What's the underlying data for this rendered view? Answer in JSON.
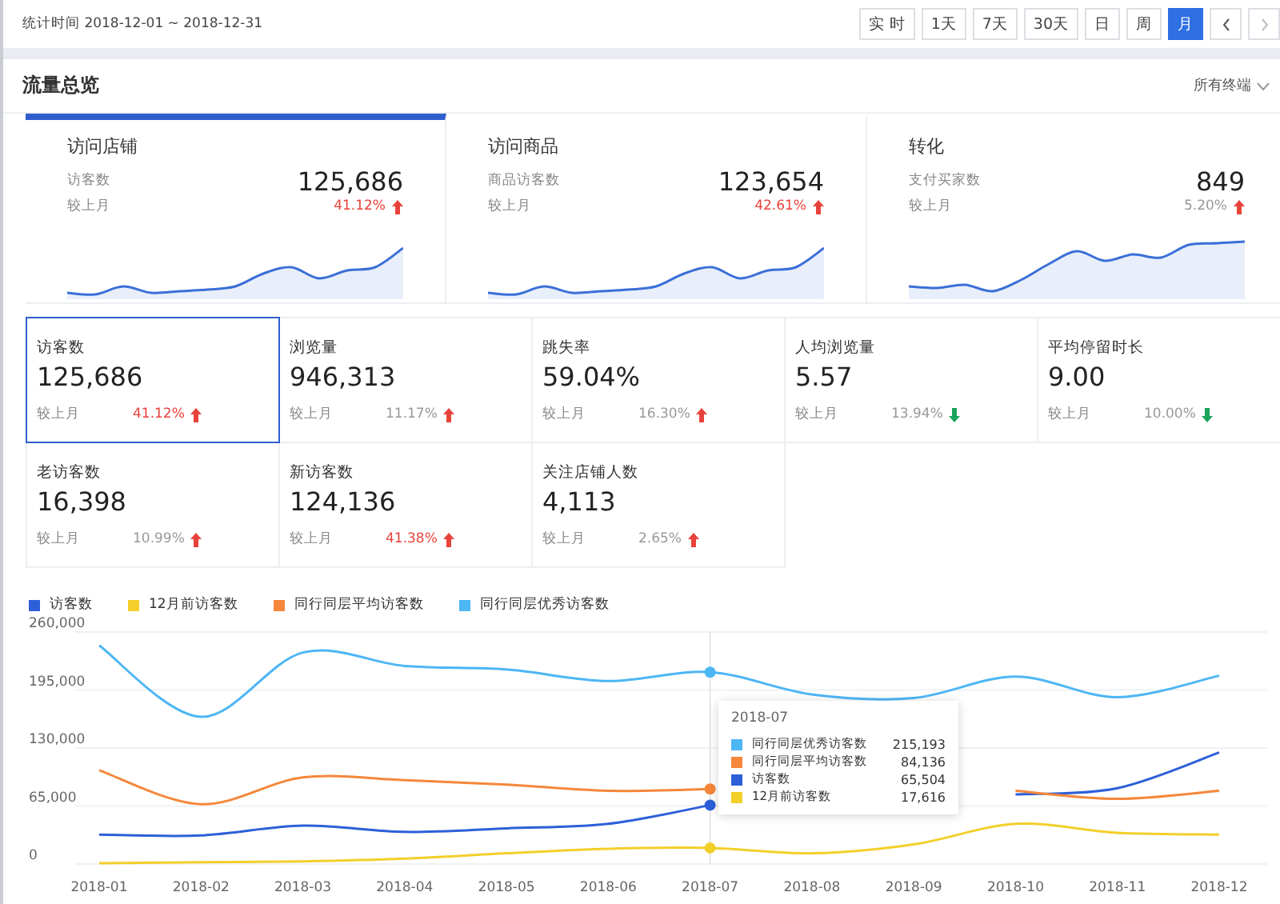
{
  "top_bar": {
    "date_range": "统计时间 2018-12-01 ~ 2018-12-31",
    "ranges": [
      {
        "label": "实 时",
        "selected": false
      },
      {
        "label": "1天",
        "selected": false
      },
      {
        "label": "7天",
        "selected": false
      },
      {
        "label": "30天",
        "selected": false
      },
      {
        "label": "日",
        "selected": false
      },
      {
        "label": "周",
        "selected": false
      },
      {
        "label": "月",
        "selected": true
      }
    ]
  },
  "panel": {
    "title": "流量总览",
    "terminal_select": "所有终端"
  },
  "summary_cards": [
    {
      "title": "访问店铺",
      "label": "访客数",
      "value": "125,686",
      "compare_label": "较上月",
      "change": "41.12%",
      "highlight": true,
      "rising": true,
      "selected": true
    },
    {
      "title": "访问商品",
      "label": "商品访客数",
      "value": "123,654",
      "compare_label": "较上月",
      "change": "42.61%",
      "highlight": true,
      "rising": true,
      "selected": false
    },
    {
      "title": "转化",
      "label": "支付买家数",
      "value": "849",
      "compare_label": "较上月",
      "change": "5.20%",
      "highlight": false,
      "rising": true,
      "selected": false
    }
  ],
  "metrics": [
    {
      "label": "访客数",
      "value": "125,686",
      "compare_label": "较上月",
      "change": "41.12%",
      "highlight": true,
      "rising": true,
      "selected": true
    },
    {
      "label": "浏览量",
      "value": "946,313",
      "compare_label": "较上月",
      "change": "11.17%",
      "highlight": false,
      "rising": true,
      "selected": false
    },
    {
      "label": "跳失率",
      "value": "59.04%",
      "compare_label": "较上月",
      "change": "16.30%",
      "highlight": false,
      "rising": true,
      "selected": false
    },
    {
      "label": "人均浏览量",
      "value": "5.57",
      "compare_label": "较上月",
      "change": "13.94%",
      "highlight": false,
      "rising": false,
      "selected": false
    },
    {
      "label": "平均停留时长",
      "value": "9.00",
      "compare_label": "较上月",
      "change": "10.00%",
      "highlight": false,
      "rising": false,
      "selected": false
    },
    {
      "label": "老访客数",
      "value": "16,398",
      "compare_label": "较上月",
      "change": "10.99%",
      "highlight": false,
      "rising": true,
      "selected": false
    },
    {
      "label": "新访客数",
      "value": "124,136",
      "compare_label": "较上月",
      "change": "41.38%",
      "highlight": true,
      "rising": true,
      "selected": false
    },
    {
      "label": "关注店铺人数",
      "value": "4,113",
      "compare_label": "较上月",
      "change": "2.65%",
      "highlight": false,
      "rising": true,
      "selected": false
    }
  ],
  "trend_chart": {
    "chart_data": {
      "type": "line",
      "grid": true,
      "ref_lines": [
        {
          "axis": "x",
          "value": "2018-07"
        }
      ],
      "categories": [
        "2018-01",
        "2018-02",
        "2018-03",
        "2018-04",
        "2018-05",
        "2018-06",
        "2018-07",
        "2018-08",
        "2018-09",
        "2018-10",
        "2018-11",
        "2018-12"
      ],
      "ylim": [
        0,
        260000
      ],
      "yticks": [
        {
          "value": 0,
          "label": "0"
        },
        {
          "value": 65000,
          "label": "65,000"
        },
        {
          "value": 130000,
          "label": "130,000"
        },
        {
          "value": 195000,
          "label": "195,000"
        },
        {
          "value": 260000,
          "label": "260,000"
        }
      ],
      "series": [
        {
          "name": "访客数",
          "color": "#2d5fd8",
          "values": [
            33000,
            32000,
            43000,
            36000,
            40000,
            45000,
            66000,
            null,
            null,
            78000,
            85000,
            125000
          ]
        },
        {
          "name": "12月前访客数",
          "color": "#f3cf2a",
          "values": [
            1000,
            2000,
            3000,
            6000,
            12000,
            17000,
            18000,
            12000,
            22000,
            45000,
            35000,
            33000
          ]
        },
        {
          "name": "同行同层平均访客数",
          "color": "#f5873a",
          "values": [
            105000,
            67000,
            97000,
            94000,
            89000,
            82000,
            84000,
            null,
            null,
            82000,
            73000,
            82000
          ]
        },
        {
          "name": "同行同层优秀访客数",
          "color": "#4db6f5",
          "values": [
            245000,
            165000,
            237000,
            222000,
            218000,
            205000,
            215000,
            190000,
            186000,
            210000,
            187000,
            211000
          ]
        }
      ]
    },
    "tooltip": {
      "title": "2018-07",
      "rows": [
        {
          "name": "同行同层优秀访客数",
          "value": "215,193",
          "color": "#4db6f5"
        },
        {
          "name": "同行同层平均访客数",
          "value": "84,136",
          "color": "#f5873a"
        },
        {
          "name": "访客数",
          "value": "65,504",
          "color": "#2d5fd8"
        },
        {
          "name": "12月前访客数",
          "value": "17,616",
          "color": "#f3cf2a"
        }
      ]
    }
  }
}
